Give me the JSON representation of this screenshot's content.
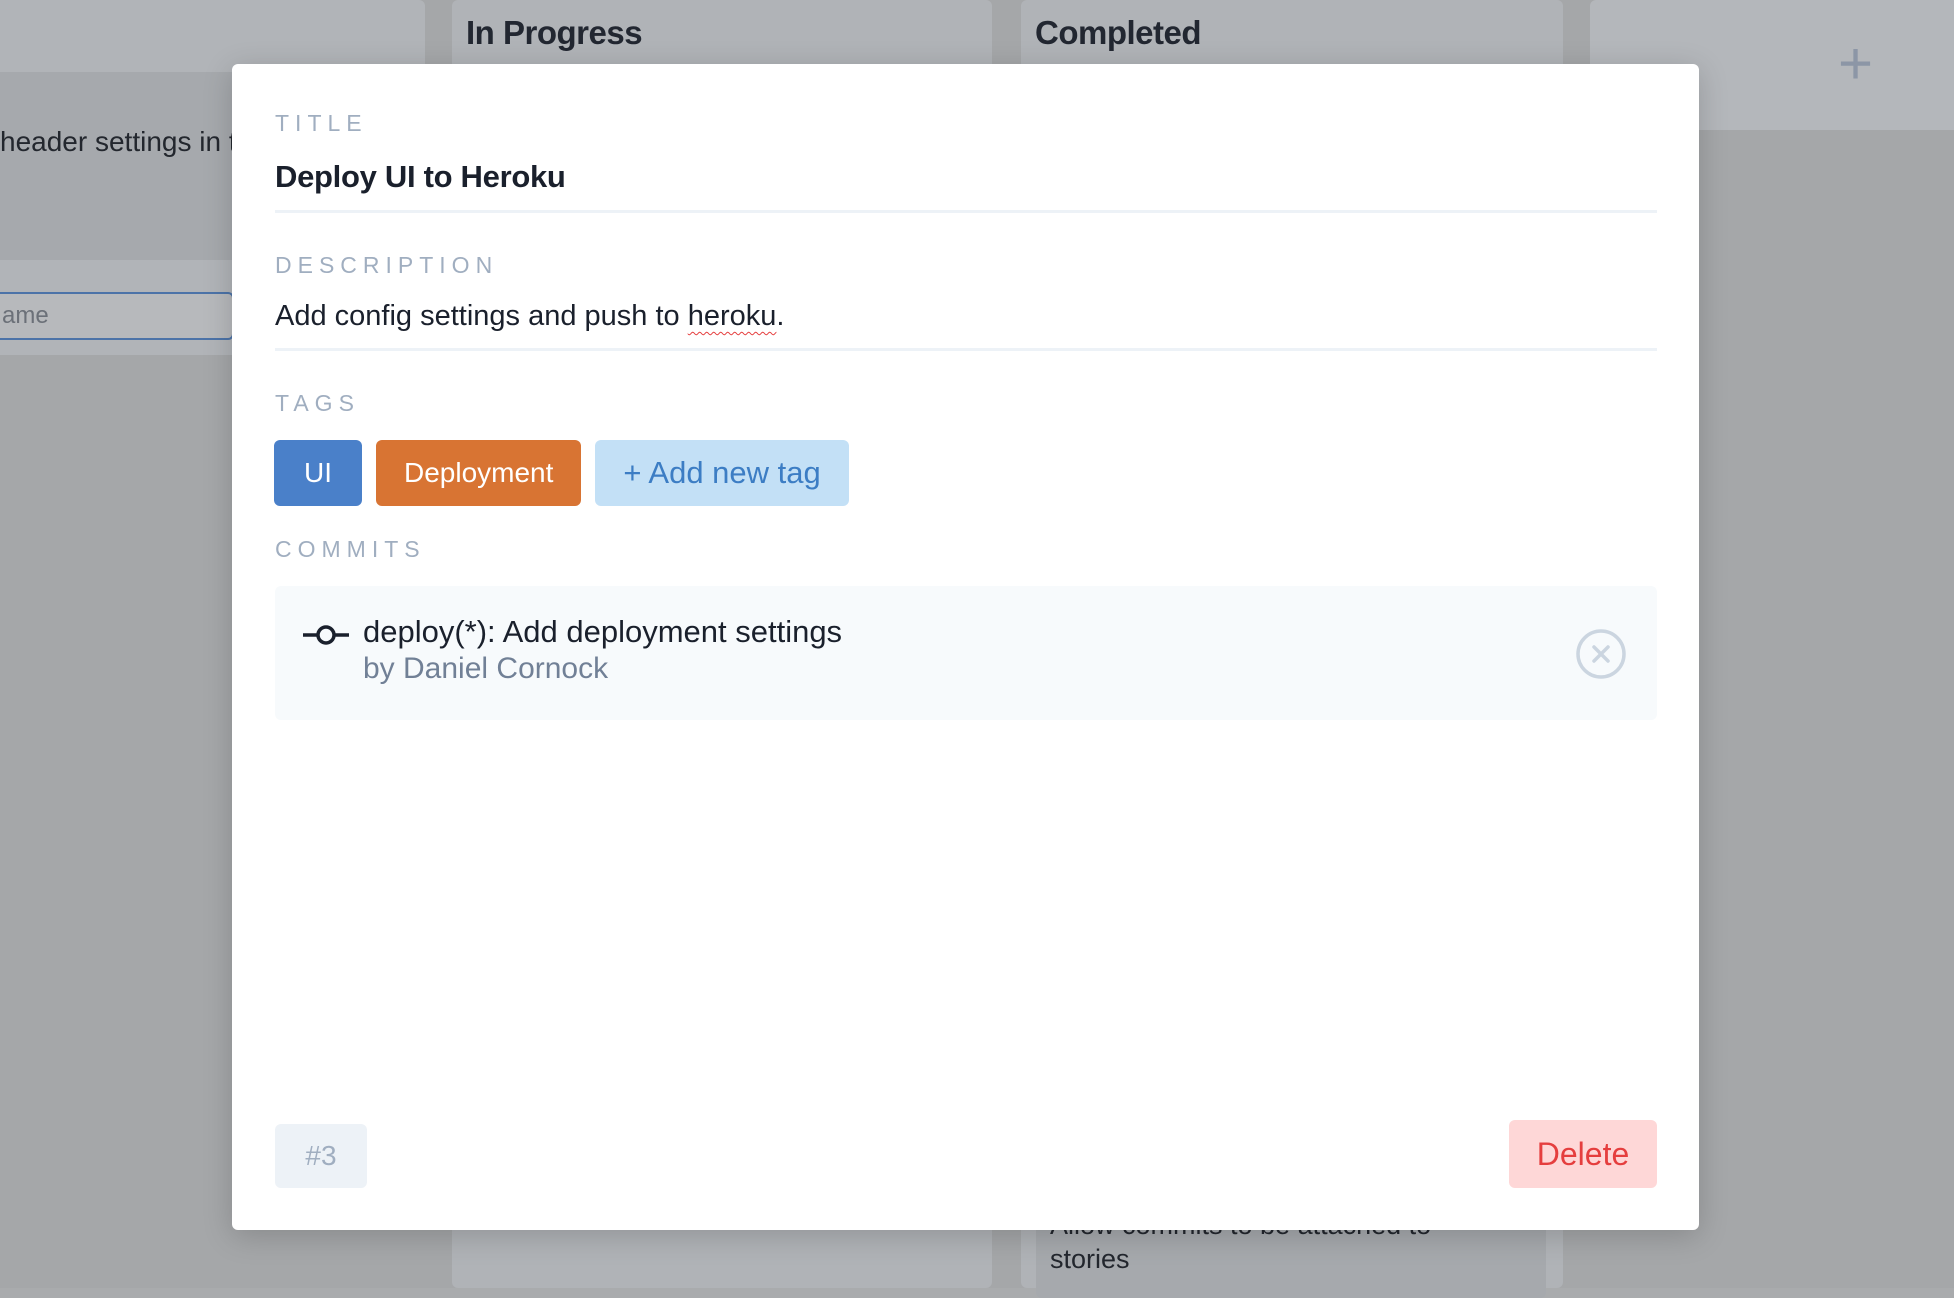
{
  "board": {
    "columns": [
      {
        "title": ""
      },
      {
        "title": "In Progress"
      },
      {
        "title": "Completed"
      }
    ],
    "left_card_text": "header settings in t",
    "left_input_placeholder": "ame",
    "completed_card_text": "Allow commits to be attached to stories",
    "add_column_label": "+"
  },
  "modal": {
    "title_label": "TITLE",
    "title_value": "Deploy UI to Heroku",
    "description_label": "DESCRIPTION",
    "description_prefix": "Add config settings and push to ",
    "description_misspelled": "heroku",
    "description_suffix": ".",
    "tags_label": "TAGS",
    "tags": [
      {
        "label": "UI",
        "color": "#4a80c9"
      },
      {
        "label": "Deployment",
        "color": "#d87433"
      }
    ],
    "add_tag_label": "+ Add new tag",
    "commits_label": "COMMITS",
    "commits": [
      {
        "message": "deploy(*): Add deployment settings",
        "author": "by Daniel Cornock",
        "icon": "git-commit-icon"
      }
    ],
    "story_number": "#3",
    "delete_label": "Delete"
  },
  "colors": {
    "label": "#a0aec0",
    "delete_text": "#e53e3e",
    "delete_bg": "#fed7d7",
    "add_tag_bg": "#c3e0f6"
  }
}
